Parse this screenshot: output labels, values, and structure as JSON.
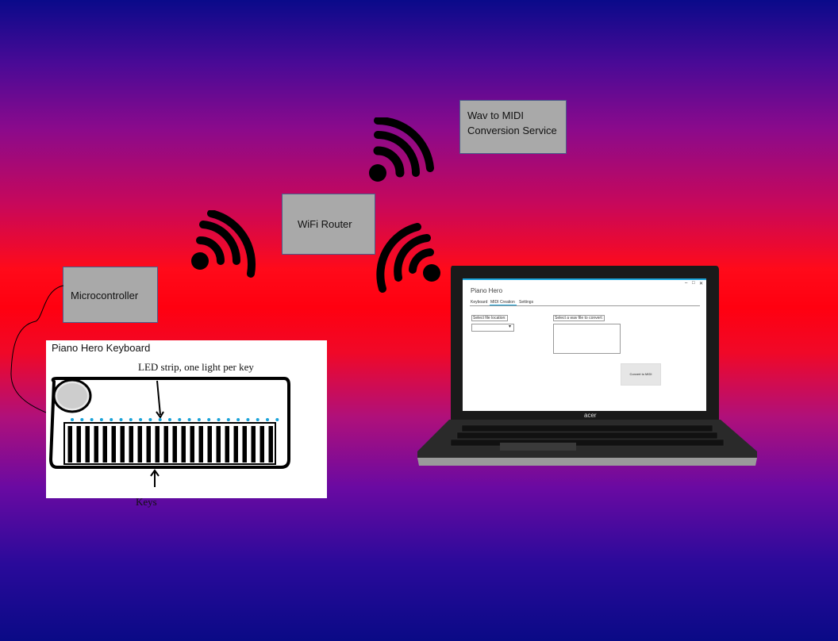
{
  "labels": {
    "wav_line1": "Wav to MIDI",
    "wav_line2": "Conversion Service",
    "router": "WiFi Router",
    "microcontroller": "Microcontroller",
    "keyboard_title": "Piano Hero Keyboard",
    "led_strip": "LED strip, one light per key",
    "keys": "Keys"
  },
  "app": {
    "title": "Piano Hero",
    "tabs": [
      "Keyboard",
      "MIDI Creation",
      "Settings"
    ],
    "select_location_label": "Select file location:",
    "select_wav_label": "Select a wav file to convert:",
    "convert_button": "Convert to MIDI",
    "minimize": "–",
    "maximize": "□",
    "close": "✕"
  },
  "laptop_brand": "acer",
  "colors": {
    "accent": "#1aa3d9",
    "box_fill": "#a9a9a9",
    "led": "#1aa3d9"
  },
  "icons": [
    "wifi-icon",
    "wifi-icon",
    "wifi-icon"
  ]
}
